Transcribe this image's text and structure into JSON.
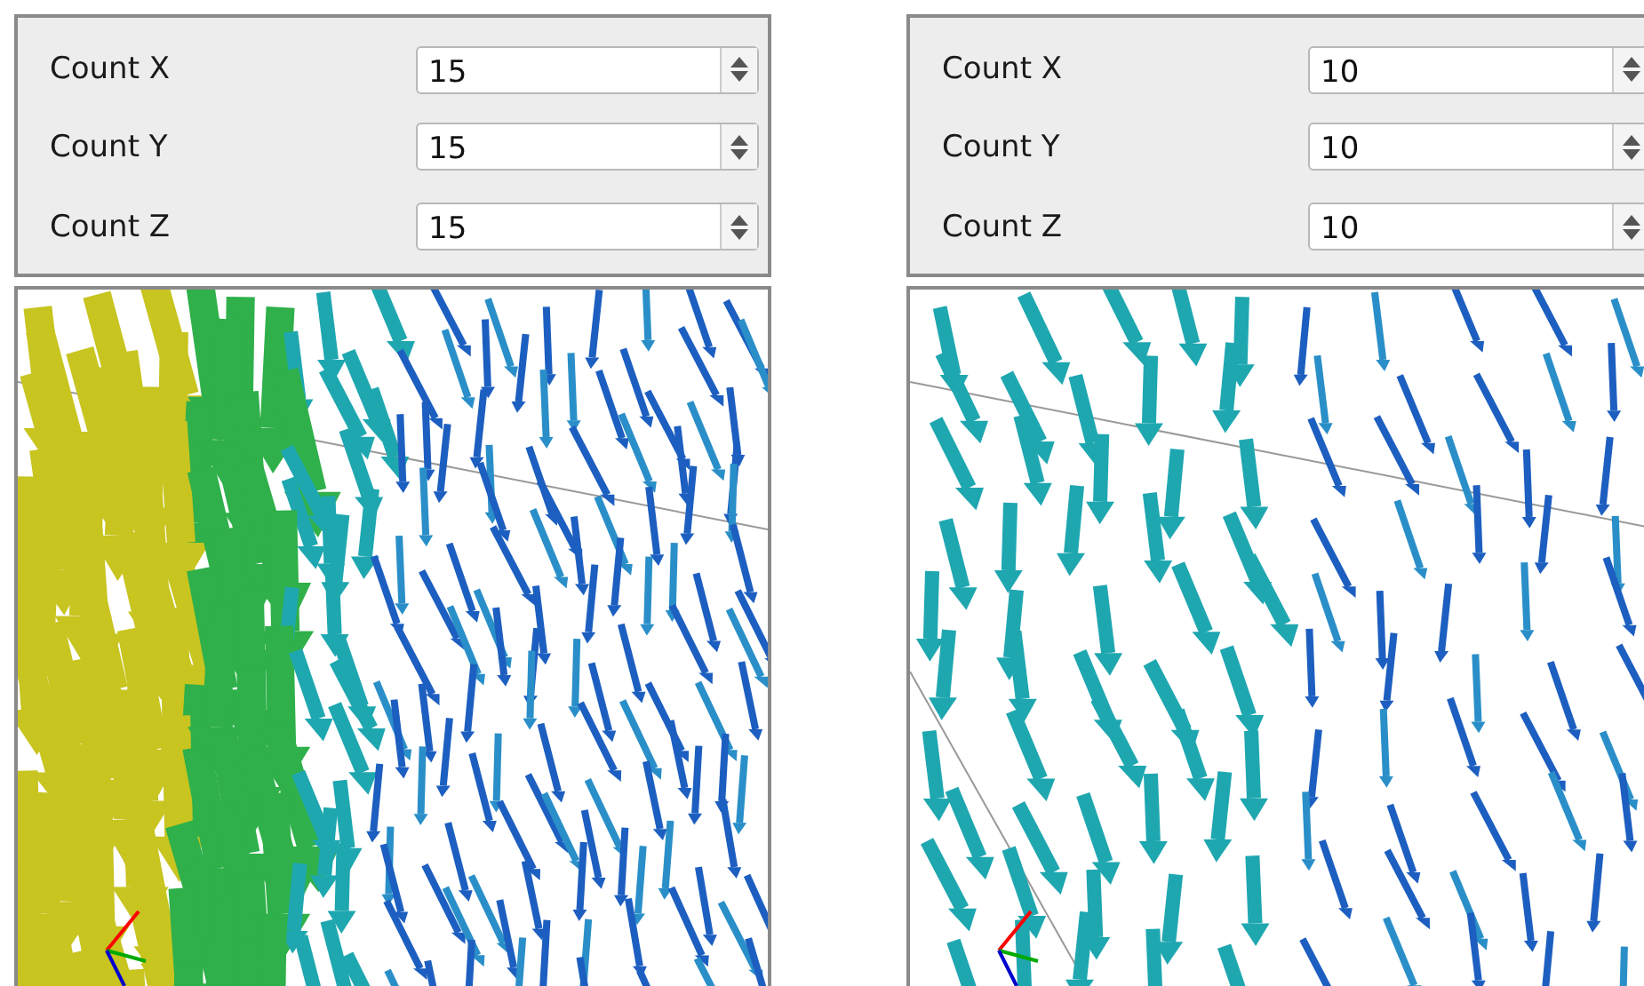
{
  "panels": [
    {
      "fields": [
        {
          "label": "Count X",
          "value": "15"
        },
        {
          "label": "Count Y",
          "value": "15"
        },
        {
          "label": "Count Z",
          "value": "15"
        }
      ]
    },
    {
      "fields": [
        {
          "label": "Count X",
          "value": "10"
        },
        {
          "label": "Count Y",
          "value": "10"
        },
        {
          "label": "Count Z",
          "value": "10"
        }
      ]
    }
  ]
}
